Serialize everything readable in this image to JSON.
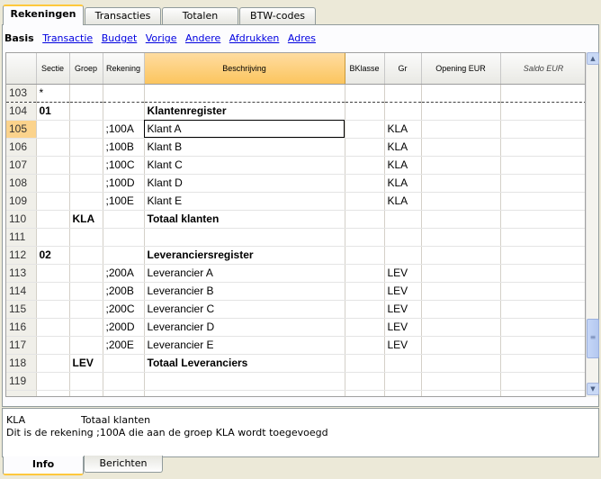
{
  "tabs": [
    "Rekeningen",
    "Transacties",
    "Totalen",
    "BTW-codes"
  ],
  "subnav": [
    "Basis",
    "Transactie",
    "Budget",
    "Vorige",
    "Andere",
    "Afdrukken",
    "Adres"
  ],
  "columns": [
    "Sectie",
    "Groep",
    "Rekening",
    "Beschrijving",
    "BKlasse",
    "Gr",
    "Opening EUR",
    "Saldo EUR"
  ],
  "rows": [
    {
      "n": "103",
      "sectie": "*",
      "groep": "",
      "rekening": "",
      "beschr": "",
      "bklasse": "",
      "gr": ""
    },
    {
      "n": "104",
      "sectie": "01",
      "groep": "",
      "rekening": "",
      "beschr": "Klantenregister",
      "bklasse": "",
      "gr": ""
    },
    {
      "n": "105",
      "sectie": "",
      "groep": "",
      "rekening": ";100A",
      "beschr": "Klant A",
      "bklasse": "",
      "gr": "KLA"
    },
    {
      "n": "106",
      "sectie": "",
      "groep": "",
      "rekening": ";100B",
      "beschr": "Klant B",
      "bklasse": "",
      "gr": "KLA"
    },
    {
      "n": "107",
      "sectie": "",
      "groep": "",
      "rekening": ";100C",
      "beschr": "Klant C",
      "bklasse": "",
      "gr": "KLA"
    },
    {
      "n": "108",
      "sectie": "",
      "groep": "",
      "rekening": ";100D",
      "beschr": "Klant D",
      "bklasse": "",
      "gr": "KLA"
    },
    {
      "n": "109",
      "sectie": "",
      "groep": "",
      "rekening": ";100E",
      "beschr": "Klant E",
      "bklasse": "",
      "gr": "KLA"
    },
    {
      "n": "110",
      "sectie": "",
      "groep": "KLA",
      "rekening": "",
      "beschr": "Totaal klanten",
      "bklasse": "",
      "gr": ""
    },
    {
      "n": "111",
      "sectie": "",
      "groep": "",
      "rekening": "",
      "beschr": "",
      "bklasse": "",
      "gr": ""
    },
    {
      "n": "112",
      "sectie": "02",
      "groep": "",
      "rekening": "",
      "beschr": "Leveranciersregister",
      "bklasse": "",
      "gr": ""
    },
    {
      "n": "113",
      "sectie": "",
      "groep": "",
      "rekening": ";200A",
      "beschr": "Leverancier A",
      "bklasse": "",
      "gr": "LEV"
    },
    {
      "n": "114",
      "sectie": "",
      "groep": "",
      "rekening": ";200B",
      "beschr": "Leverancier B",
      "bklasse": "",
      "gr": "LEV"
    },
    {
      "n": "115",
      "sectie": "",
      "groep": "",
      "rekening": ";200C",
      "beschr": "Leverancier C",
      "bklasse": "",
      "gr": "LEV"
    },
    {
      "n": "116",
      "sectie": "",
      "groep": "",
      "rekening": ";200D",
      "beschr": "Leverancier D",
      "bklasse": "",
      "gr": "LEV"
    },
    {
      "n": "117",
      "sectie": "",
      "groep": "",
      "rekening": ";200E",
      "beschr": "Leverancier E",
      "bklasse": "",
      "gr": "LEV"
    },
    {
      "n": "118",
      "sectie": "",
      "groep": "LEV",
      "rekening": "",
      "beschr": "Totaal Leveranciers",
      "bklasse": "",
      "gr": ""
    },
    {
      "n": "119",
      "sectie": "",
      "groep": "",
      "rekening": "",
      "beschr": "",
      "bklasse": "",
      "gr": ""
    },
    {
      "n": "",
      "sectie": "",
      "groep": "",
      "rekening": "",
      "beschr": "",
      "bklasse": "",
      "gr": ""
    }
  ],
  "info": {
    "line1_code": "KLA",
    "line1_text": "Totaal klanten",
    "line2": "Dit is de rekening ;100A die aan de groep KLA wordt toegevoegd"
  },
  "bottom_tabs": [
    "Info",
    "Berichten"
  ],
  "colors": {
    "accent": "#fbc55e",
    "current_row": "#fbd38c",
    "link": "#0000e0"
  },
  "icons": {
    "scroll_up": "▲",
    "scroll_down": "▼",
    "grip": "≡"
  }
}
